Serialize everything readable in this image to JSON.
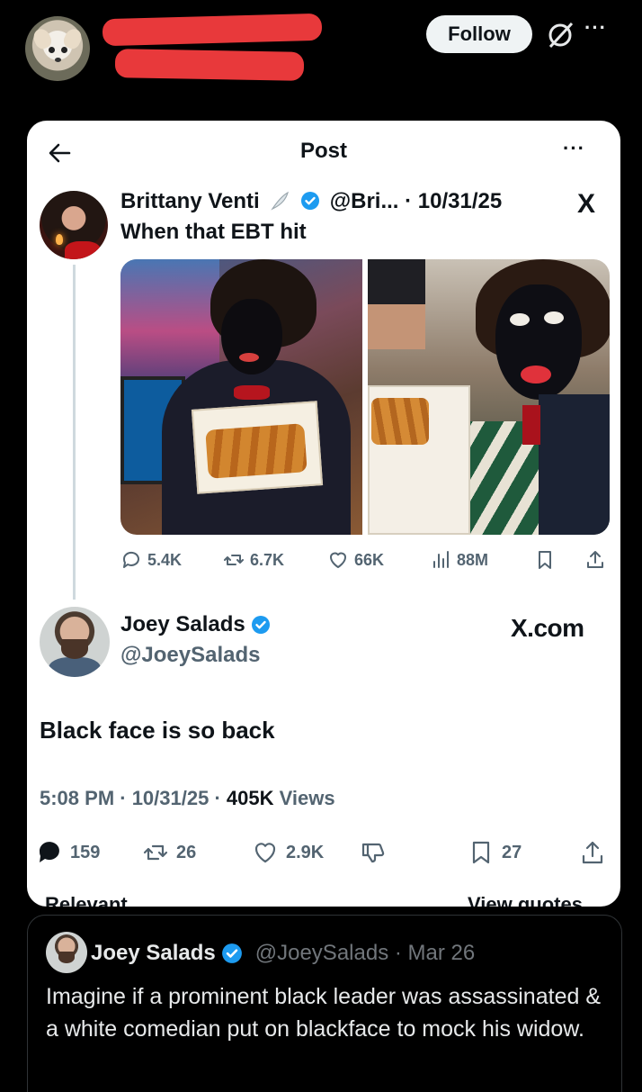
{
  "topbar": {
    "follow_label": "Follow",
    "more_label": "···"
  },
  "card": {
    "title": "Post",
    "more_label": "···",
    "quoted_post": {
      "name": "Brittany Venti",
      "handle_date": "@Bri... · 10/31/25",
      "text": "When that EBT hit",
      "platform_logo": "X",
      "stats": {
        "replies": "5.4K",
        "reposts": "6.7K",
        "likes": "66K",
        "views": "88M"
      }
    },
    "main_post": {
      "name": "Joey Salads",
      "handle": "@JoeySalads",
      "site": "X.com",
      "text": "Black face is so back",
      "time": "5:08 PM · 10/31/25 · ",
      "views_count": "405K",
      "views_label": " Views",
      "stats": {
        "replies": "159",
        "reposts": "26",
        "likes": "2.9K",
        "bookmarks": "27"
      },
      "cut_left": "Relevant",
      "cut_right": "View quotes"
    }
  },
  "quote_tweet": {
    "name": "Joey Salads",
    "handle_date": "@JoeySalads · Mar 26",
    "text": "Imagine if a prominent black leader was assassinated & a white comedian put on blackface to mock his widow."
  },
  "colors": {
    "verified": "#1d9bf0",
    "redaction": "#e8393b",
    "muted": "#536471"
  }
}
